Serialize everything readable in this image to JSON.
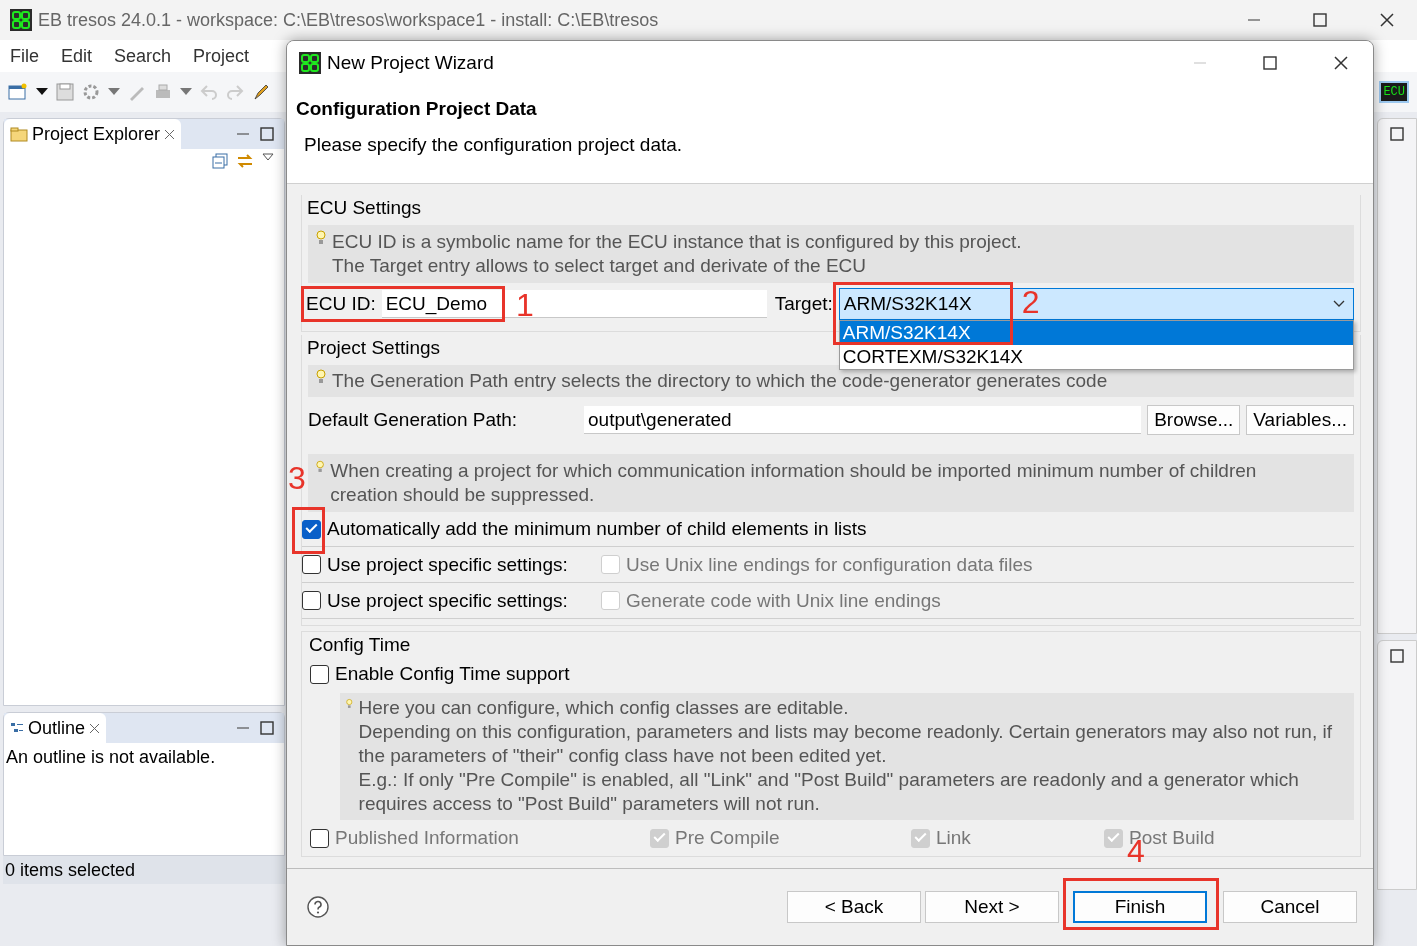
{
  "main_window": {
    "title": "EB tresos 24.0.1 - workspace: C:\\EB\\tresos\\workspace1 - install: C:\\EB\\tresos",
    "menu": [
      "File",
      "Edit",
      "Search",
      "Project"
    ],
    "perspective_button": "ECU",
    "views": [
      {
        "title": "Project Explorer"
      },
      {
        "title": "Outline",
        "message": "An outline is not available."
      }
    ],
    "status_bar": "0 items selected"
  },
  "dialog": {
    "title": "New Project Wizard",
    "heading": "Configuration Project Data",
    "description": "Please specify the configuration project data.",
    "ecu_settings": {
      "title": "ECU Settings",
      "hint_lines": [
        "ECU ID is a symbolic name for the ECU instance that is configured by this project.",
        "The Target entry allows to select target and derivate of the ECU"
      ],
      "ecu_id_label": "ECU ID:",
      "ecu_id_value": "ECU_Demo",
      "target_label": "Target:",
      "target_value": "ARM/S32K14X",
      "target_options": [
        {
          "label": "ARM/S32K14X",
          "selected": true
        },
        {
          "label": "CORTEXM/S32K14X",
          "selected": false
        }
      ]
    },
    "project_settings": {
      "title": "Project Settings",
      "hint": "The Generation Path entry selects the directory to which the code-generator generates code",
      "path_label": "Default Generation Path:",
      "path_value": "output\\generated",
      "path_buttons": [
        "Browse...",
        "Variables..."
      ],
      "import_hint": "When creating a project for which communication information should be imported minimum number of children creation should be suppressed.",
      "auto_add": {
        "label": "Automatically add the minimum number of child elements in lists",
        "checked": true
      },
      "specific_rows": [
        {
          "label": "Use project specific settings:",
          "checked": false,
          "option": "Use Unix line endings for configuration data files",
          "option_checked": false,
          "option_disabled": true
        },
        {
          "label": "Use project specific settings:",
          "checked": false,
          "option": "Generate code with Unix line endings",
          "option_checked": false,
          "option_disabled": true
        }
      ]
    },
    "config_time": {
      "title": "Config Time",
      "enable": {
        "label": "Enable Config Time support",
        "checked": false
      },
      "hint_lines": [
        "Here you can configure, which config classes are editable.",
        "Depending on this configuration, parameters and lists may become readonly. Certain generators may also not run, if the parameters of \"their\" config class have not been edited yet.",
        "E.g.: If only \"Pre Compile\" is enabled, all \"Link\" and \"Post Build\" parameters are readonly and a generator which requires access to \"Post Build\" parameters will not run."
      ],
      "classes": [
        {
          "label": "Published Information",
          "checked": false,
          "disabled": false
        },
        {
          "label": "Pre Compile",
          "checked": true,
          "disabled": true
        },
        {
          "label": "Link",
          "checked": true,
          "disabled": true
        },
        {
          "label": "Post Build",
          "checked": true,
          "disabled": true
        }
      ]
    },
    "buttons": [
      {
        "label": "< Back",
        "default": false
      },
      {
        "label": "Next >",
        "default": false
      },
      {
        "label": "Finish",
        "default": true
      },
      {
        "label": "Cancel",
        "default": false
      }
    ]
  },
  "annotations": [
    {
      "label": "1"
    },
    {
      "label": "2"
    },
    {
      "label": "3"
    },
    {
      "label": "4"
    }
  ]
}
